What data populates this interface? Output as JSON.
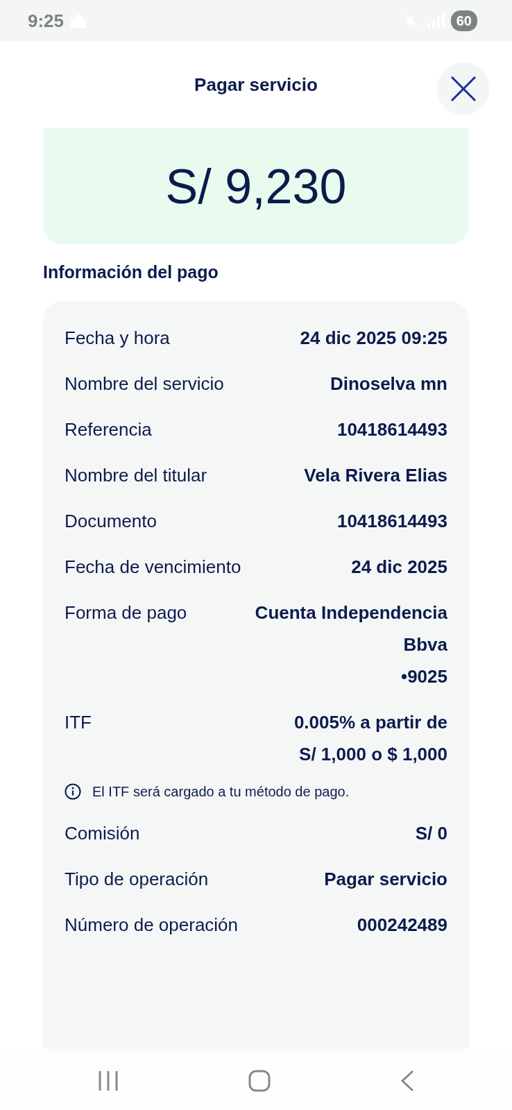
{
  "status_bar": {
    "time": "9:25",
    "battery": "60"
  },
  "header": {
    "title": "Pagar servicio"
  },
  "amount": {
    "value": "S/ 9,230"
  },
  "section_title": "Información del pago",
  "rows": [
    {
      "kind": "field",
      "label": "Fecha y hora",
      "value": [
        "24 dic 2025 09:25"
      ]
    },
    {
      "kind": "field",
      "label": "Nombre del servicio",
      "value": [
        "Dinoselva mn"
      ]
    },
    {
      "kind": "field",
      "label": "Referencia",
      "value": [
        "10418614493"
      ]
    },
    {
      "kind": "field",
      "label": "Nombre del titular",
      "value": [
        "Vela Rivera Elias"
      ]
    },
    {
      "kind": "field",
      "label": "Documento",
      "value": [
        "10418614493"
      ]
    },
    {
      "kind": "field",
      "label": "Fecha de vencimiento",
      "value": [
        "24 dic 2025"
      ]
    },
    {
      "kind": "field",
      "label": "Forma de pago",
      "value": [
        "Cuenta Independencia",
        "Bbva",
        "•9025"
      ]
    },
    {
      "kind": "field",
      "label": "ITF",
      "value": [
        "0.005% a partir de",
        "S/ 1,000 o $ 1,000"
      ]
    },
    {
      "kind": "note",
      "text": "El ITF será cargado a tu método de pago."
    },
    {
      "kind": "field",
      "label": "Comisión",
      "value": [
        "S/ 0"
      ]
    },
    {
      "kind": "field",
      "label": "Tipo de operación",
      "value": [
        "Pagar servicio"
      ]
    },
    {
      "kind": "field",
      "label": "Número de operación",
      "value": [
        "000242489"
      ]
    }
  ]
}
